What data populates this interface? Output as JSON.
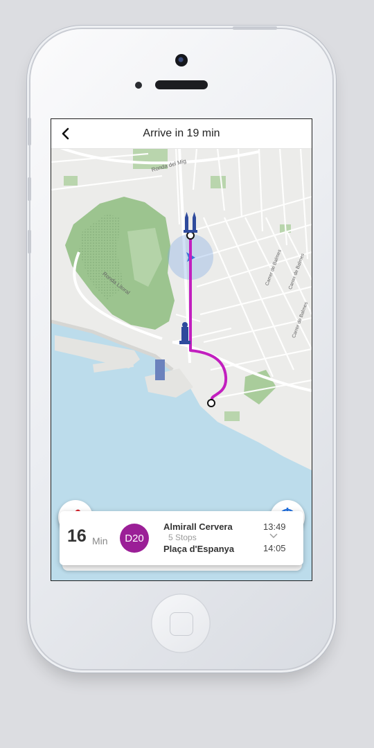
{
  "header": {
    "title": "Arrive in 19 min"
  },
  "map": {
    "street_labels": [
      "Ronda del Mig",
      "Ronda Litoral",
      "Carrer de Balmes",
      "Carrer de Balmes",
      "Carrer de Balmes"
    ],
    "route_color": "#c21fbf",
    "water_color": "#bcdceb",
    "park_color": "#9cc48f"
  },
  "route_card": {
    "duration_value": "16",
    "duration_unit": "Min",
    "line_code": "D20",
    "line_color": "#9b1f97",
    "origin_stop": "Almirall Cervera",
    "stops_count": "5 Stops",
    "destination_stop": "Plaça d'Espanya",
    "departure_time": "13:49",
    "arrival_time": "14:05"
  },
  "icons": {
    "back": "chevron-left-icon",
    "ticket": "ticket-icon",
    "locate": "crosshair-icon"
  }
}
